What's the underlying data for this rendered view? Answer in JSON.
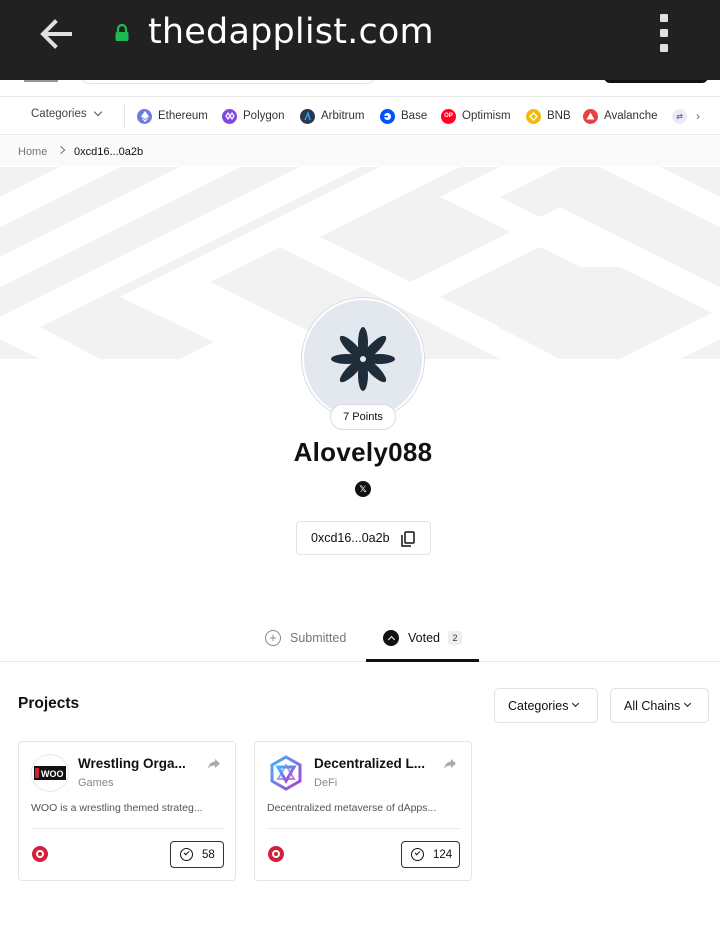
{
  "browser": {
    "url": "thedapplist.com"
  },
  "nav": {
    "categories_label": "Categories",
    "chains": [
      {
        "label": "Ethereum",
        "color": "#6c7ce0"
      },
      {
        "label": "Polygon",
        "color": "#8247e5"
      },
      {
        "label": "Arbitrum",
        "color": "#2d374b"
      },
      {
        "label": "Base",
        "color": "#0052ff"
      },
      {
        "label": "Optimism",
        "color": "#ff0420"
      },
      {
        "label": "BNB",
        "color": "#f0b90b"
      },
      {
        "label": "Avalanche",
        "color": "#e84142"
      }
    ]
  },
  "breadcrumb": {
    "home": "Home",
    "current": "0xcd16...0a2b"
  },
  "profile": {
    "points": "7 Points",
    "username": "Alovely088",
    "x_glyph": "𝕏",
    "address": "0xcd16...0a2b"
  },
  "tabs": {
    "submitted": "Submitted",
    "voted": "Voted",
    "voted_count": "2"
  },
  "projects": {
    "title": "Projects",
    "filter_categories": "Categories",
    "filter_chains": "All Chains",
    "cards": [
      {
        "name": "Wrestling Orga...",
        "category": "Games",
        "description": "WOO is a wrestling themed strateg...",
        "votes": "58",
        "logo_text": "WOO"
      },
      {
        "name": "Decentralized L...",
        "category": "DeFi",
        "description": "Decentralized metaverse of dApps...",
        "votes": "124"
      }
    ]
  },
  "colors": {
    "browser_bar": "#212121",
    "lock": "#1db954",
    "chain_badge": "#d21f3a",
    "accent": "#111111"
  }
}
